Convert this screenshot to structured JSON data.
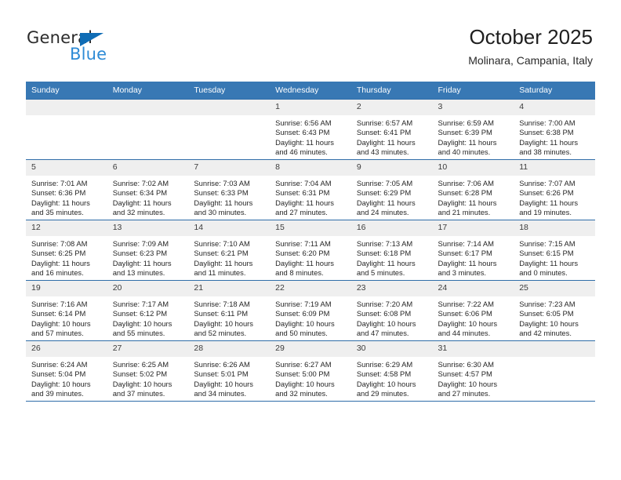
{
  "brand": {
    "line1": "General",
    "line2": "Blue",
    "triangle_color": "#0f6cb5",
    "blue_text_color": "#2e8bd6"
  },
  "header": {
    "title": "October 2025",
    "subtitle": "Molinara, Campania, Italy"
  },
  "theme": {
    "header_row_bg": "#3878b4",
    "row_rule": "#2f6da8",
    "daynum_bg": "#efefef"
  },
  "weekday_headers": [
    "Sunday",
    "Monday",
    "Tuesday",
    "Wednesday",
    "Thursday",
    "Friday",
    "Saturday"
  ],
  "labels": {
    "sunrise_prefix": "Sunrise:",
    "sunset_prefix": "Sunset:",
    "daylight_prefix": "Daylight:"
  },
  "weeks": [
    [
      {
        "day": "",
        "lines": []
      },
      {
        "day": "",
        "lines": []
      },
      {
        "day": "",
        "lines": []
      },
      {
        "day": "1",
        "lines": [
          "Sunrise: 6:56 AM",
          "Sunset: 6:43 PM",
          "Daylight: 11 hours",
          "and 46 minutes."
        ]
      },
      {
        "day": "2",
        "lines": [
          "Sunrise: 6:57 AM",
          "Sunset: 6:41 PM",
          "Daylight: 11 hours",
          "and 43 minutes."
        ]
      },
      {
        "day": "3",
        "lines": [
          "Sunrise: 6:59 AM",
          "Sunset: 6:39 PM",
          "Daylight: 11 hours",
          "and 40 minutes."
        ]
      },
      {
        "day": "4",
        "lines": [
          "Sunrise: 7:00 AM",
          "Sunset: 6:38 PM",
          "Daylight: 11 hours",
          "and 38 minutes."
        ]
      }
    ],
    [
      {
        "day": "5",
        "lines": [
          "Sunrise: 7:01 AM",
          "Sunset: 6:36 PM",
          "Daylight: 11 hours",
          "and 35 minutes."
        ]
      },
      {
        "day": "6",
        "lines": [
          "Sunrise: 7:02 AM",
          "Sunset: 6:34 PM",
          "Daylight: 11 hours",
          "and 32 minutes."
        ]
      },
      {
        "day": "7",
        "lines": [
          "Sunrise: 7:03 AM",
          "Sunset: 6:33 PM",
          "Daylight: 11 hours",
          "and 30 minutes."
        ]
      },
      {
        "day": "8",
        "lines": [
          "Sunrise: 7:04 AM",
          "Sunset: 6:31 PM",
          "Daylight: 11 hours",
          "and 27 minutes."
        ]
      },
      {
        "day": "9",
        "lines": [
          "Sunrise: 7:05 AM",
          "Sunset: 6:29 PM",
          "Daylight: 11 hours",
          "and 24 minutes."
        ]
      },
      {
        "day": "10",
        "lines": [
          "Sunrise: 7:06 AM",
          "Sunset: 6:28 PM",
          "Daylight: 11 hours",
          "and 21 minutes."
        ]
      },
      {
        "day": "11",
        "lines": [
          "Sunrise: 7:07 AM",
          "Sunset: 6:26 PM",
          "Daylight: 11 hours",
          "and 19 minutes."
        ]
      }
    ],
    [
      {
        "day": "12",
        "lines": [
          "Sunrise: 7:08 AM",
          "Sunset: 6:25 PM",
          "Daylight: 11 hours",
          "and 16 minutes."
        ]
      },
      {
        "day": "13",
        "lines": [
          "Sunrise: 7:09 AM",
          "Sunset: 6:23 PM",
          "Daylight: 11 hours",
          "and 13 minutes."
        ]
      },
      {
        "day": "14",
        "lines": [
          "Sunrise: 7:10 AM",
          "Sunset: 6:21 PM",
          "Daylight: 11 hours",
          "and 11 minutes."
        ]
      },
      {
        "day": "15",
        "lines": [
          "Sunrise: 7:11 AM",
          "Sunset: 6:20 PM",
          "Daylight: 11 hours",
          "and 8 minutes."
        ]
      },
      {
        "day": "16",
        "lines": [
          "Sunrise: 7:13 AM",
          "Sunset: 6:18 PM",
          "Daylight: 11 hours",
          "and 5 minutes."
        ]
      },
      {
        "day": "17",
        "lines": [
          "Sunrise: 7:14 AM",
          "Sunset: 6:17 PM",
          "Daylight: 11 hours",
          "and 3 minutes."
        ]
      },
      {
        "day": "18",
        "lines": [
          "Sunrise: 7:15 AM",
          "Sunset: 6:15 PM",
          "Daylight: 11 hours",
          "and 0 minutes."
        ]
      }
    ],
    [
      {
        "day": "19",
        "lines": [
          "Sunrise: 7:16 AM",
          "Sunset: 6:14 PM",
          "Daylight: 10 hours",
          "and 57 minutes."
        ]
      },
      {
        "day": "20",
        "lines": [
          "Sunrise: 7:17 AM",
          "Sunset: 6:12 PM",
          "Daylight: 10 hours",
          "and 55 minutes."
        ]
      },
      {
        "day": "21",
        "lines": [
          "Sunrise: 7:18 AM",
          "Sunset: 6:11 PM",
          "Daylight: 10 hours",
          "and 52 minutes."
        ]
      },
      {
        "day": "22",
        "lines": [
          "Sunrise: 7:19 AM",
          "Sunset: 6:09 PM",
          "Daylight: 10 hours",
          "and 50 minutes."
        ]
      },
      {
        "day": "23",
        "lines": [
          "Sunrise: 7:20 AM",
          "Sunset: 6:08 PM",
          "Daylight: 10 hours",
          "and 47 minutes."
        ]
      },
      {
        "day": "24",
        "lines": [
          "Sunrise: 7:22 AM",
          "Sunset: 6:06 PM",
          "Daylight: 10 hours",
          "and 44 minutes."
        ]
      },
      {
        "day": "25",
        "lines": [
          "Sunrise: 7:23 AM",
          "Sunset: 6:05 PM",
          "Daylight: 10 hours",
          "and 42 minutes."
        ]
      }
    ],
    [
      {
        "day": "26",
        "lines": [
          "Sunrise: 6:24 AM",
          "Sunset: 5:04 PM",
          "Daylight: 10 hours",
          "and 39 minutes."
        ]
      },
      {
        "day": "27",
        "lines": [
          "Sunrise: 6:25 AM",
          "Sunset: 5:02 PM",
          "Daylight: 10 hours",
          "and 37 minutes."
        ]
      },
      {
        "day": "28",
        "lines": [
          "Sunrise: 6:26 AM",
          "Sunset: 5:01 PM",
          "Daylight: 10 hours",
          "and 34 minutes."
        ]
      },
      {
        "day": "29",
        "lines": [
          "Sunrise: 6:27 AM",
          "Sunset: 5:00 PM",
          "Daylight: 10 hours",
          "and 32 minutes."
        ]
      },
      {
        "day": "30",
        "lines": [
          "Sunrise: 6:29 AM",
          "Sunset: 4:58 PM",
          "Daylight: 10 hours",
          "and 29 minutes."
        ]
      },
      {
        "day": "31",
        "lines": [
          "Sunrise: 6:30 AM",
          "Sunset: 4:57 PM",
          "Daylight: 10 hours",
          "and 27 minutes."
        ]
      },
      {
        "day": "",
        "lines": []
      }
    ]
  ]
}
